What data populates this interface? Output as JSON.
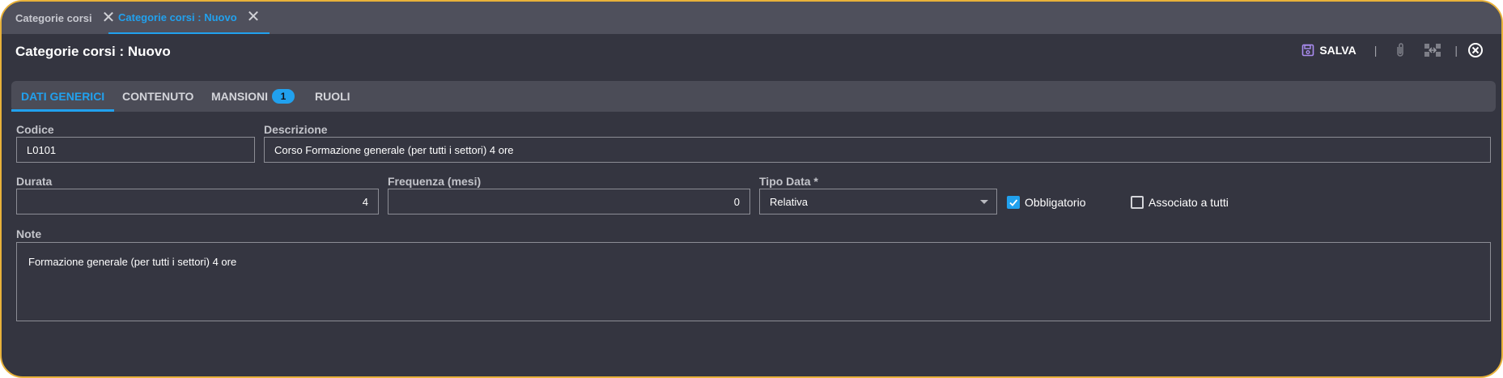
{
  "window_tabs": [
    {
      "label": "Categorie corsi",
      "active": false
    },
    {
      "label": "Categorie corsi : Nuovo",
      "active": true
    }
  ],
  "header": {
    "title": "Categorie corsi : Nuovo",
    "save_label": "SALVA",
    "separator": "|"
  },
  "form_tabs": [
    {
      "label": "DATI GENERICI",
      "active": true
    },
    {
      "label": "CONTENUTO",
      "active": false
    },
    {
      "label": "MANSIONI",
      "active": false,
      "badge": "1"
    },
    {
      "label": "RUOLI",
      "active": false
    }
  ],
  "fields": {
    "codice": {
      "label": "Codice",
      "value": "L0101"
    },
    "descrizione": {
      "label": "Descrizione",
      "value": "Corso Formazione generale (per tutti i settori) 4 ore"
    },
    "durata": {
      "label": "Durata",
      "value": "4"
    },
    "frequenza": {
      "label": "Frequenza (mesi)",
      "value": "0"
    },
    "tipo_data": {
      "label": "Tipo Data *",
      "value": "Relativa"
    },
    "obbligatorio": {
      "label": "Obbligatorio",
      "checked": true
    },
    "associato": {
      "label": "Associato a tutti",
      "checked": false
    },
    "note": {
      "label": "Note",
      "value": "Formazione generale (per tutti i settori) 4 ore"
    }
  },
  "colors": {
    "accent": "#21a1ee",
    "frame_border": "#e8b23a",
    "background": "#343540"
  }
}
